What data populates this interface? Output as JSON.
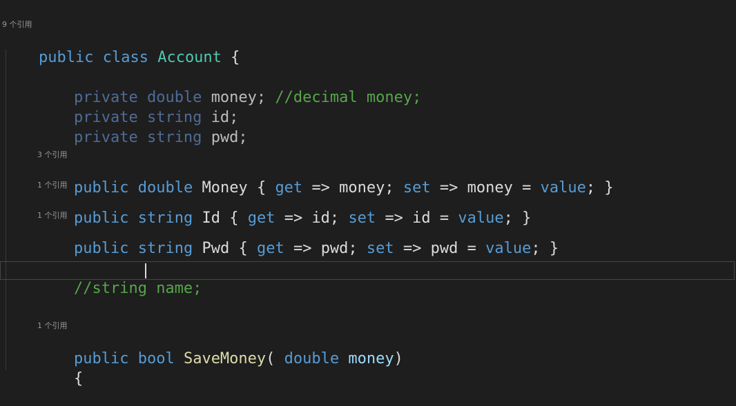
{
  "lens": {
    "class_refs": "9 个引用",
    "money_refs": "3 个引用",
    "id_refs": "1 个引用",
    "pwd_refs": "1 个引用",
    "save_refs": "1 个引用"
  },
  "code": {
    "public": "public",
    "class": "class",
    "class_name": "Account",
    "open_brace": "{",
    "private": "private",
    "double": "double",
    "string": "string",
    "bool": "bool",
    "get": "get",
    "set": "set",
    "value": "value",
    "field_money": "money;",
    "comment_decimal": "//decimal money;",
    "field_id": "id;",
    "field_pwd": "pwd;",
    "prop_money_name": "Money",
    "prop_money_body_open": "{",
    "prop_money_get_body": "=> money;",
    "prop_money_set_body": "=> money =",
    "prop_money_end": "; }",
    "prop_id_name": "Id",
    "prop_id_body_open": "{",
    "prop_id_get_body": "=> id;",
    "prop_id_set_body": "=> id =",
    "prop_id_end": "; }",
    "prop_pwd_name": "Pwd",
    "prop_pwd_body_open": "{",
    "prop_pwd_get_body": "=> pwd;",
    "prop_pwd_set_body": "=> pwd =",
    "prop_pwd_end": "; }",
    "comment_name": "//string name;",
    "method_name": "SaveMoney",
    "paren_open": "(",
    "param_name": "money",
    "paren_close": ")",
    "method_brace": "{"
  },
  "colors": {
    "background": "#1e1e1e",
    "keyword": "#569cd6",
    "type": "#4ec9b0",
    "comment": "#57a64a",
    "method": "#dcdcaa",
    "param": "#9cdcfe"
  }
}
